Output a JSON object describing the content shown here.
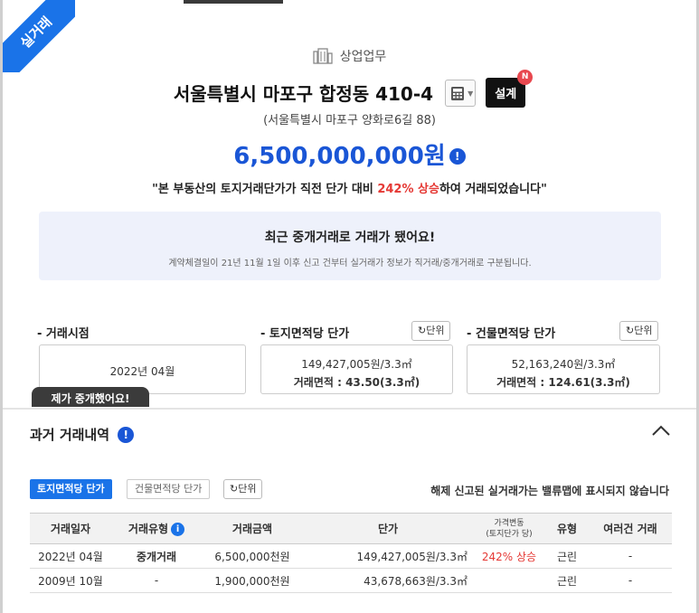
{
  "ribbon": "실거래",
  "category": "상업업무",
  "title": "서울특별시 마포구 합정동 410-4",
  "design_button": "설계",
  "design_badge": "N",
  "road_address": "(서울특별시 마포구 양화로6길 88)",
  "price": "6,500,000,000원",
  "quote_prefix": "\"본 부동산의 토지거래단가가 직전 단가 대비 ",
  "quote_highlight": "242% 상승",
  "quote_suffix": "하여 거래되었습니다\"",
  "notice": {
    "heading": "최근 중개거래로 거래가 됐어요!",
    "sub": "계약체결일이 21년 11월 1일 이후 신고 건부터 실거래가 정보가 직거래/중개거래로 구분됩니다."
  },
  "cols": {
    "trade_time_label": "- 거래시점",
    "trade_time_value": "2022년 04월",
    "land_label": "- 토지면적당 단가",
    "land_unit_btn": "단위",
    "land_price": "149,427,005원/3.3㎡",
    "land_area": "거래면적 : 43.50(3.3㎡)",
    "bldg_label": "- 건물면적당 단가",
    "bldg_unit_btn": "단위",
    "bldg_price": "52,163,240원/3.3㎡",
    "bldg_area": "거래면적 : 124.61(3.3㎡)"
  },
  "tooltip": "제가 중개했어요!",
  "history": {
    "title": "과거 거래내역",
    "tab_active": "토지면적당 단가",
    "tab_other": "건물면적당 단가",
    "tab_unit": "단위",
    "note": "해제 신고된 실거래가는 밸류맵에 표시되지 않습니다",
    "headers": [
      "거래일자",
      "거래유형",
      "거래금액",
      "단가",
      "가격변동\n(토지단가 당)",
      "유형",
      "여러건 거래"
    ],
    "header_change_line1": "가격변동",
    "header_change_line2": "(토지단가 당)",
    "rows": [
      {
        "date": "2022년 04월",
        "type": "중개거래",
        "amount": "6,500,000천원",
        "unit": "149,427,005원/3.3㎡",
        "change": "242% 상승",
        "kind": "근린",
        "multi": "-"
      },
      {
        "date": "2009년 10월",
        "type": "-",
        "amount": "1,900,000천원",
        "unit": "43,678,663원/3.3㎡",
        "change": "",
        "kind": "근린",
        "multi": "-"
      }
    ]
  },
  "colors": {
    "accent": "#1a73e8",
    "price": "#1a56d6",
    "up": "#e53935"
  }
}
